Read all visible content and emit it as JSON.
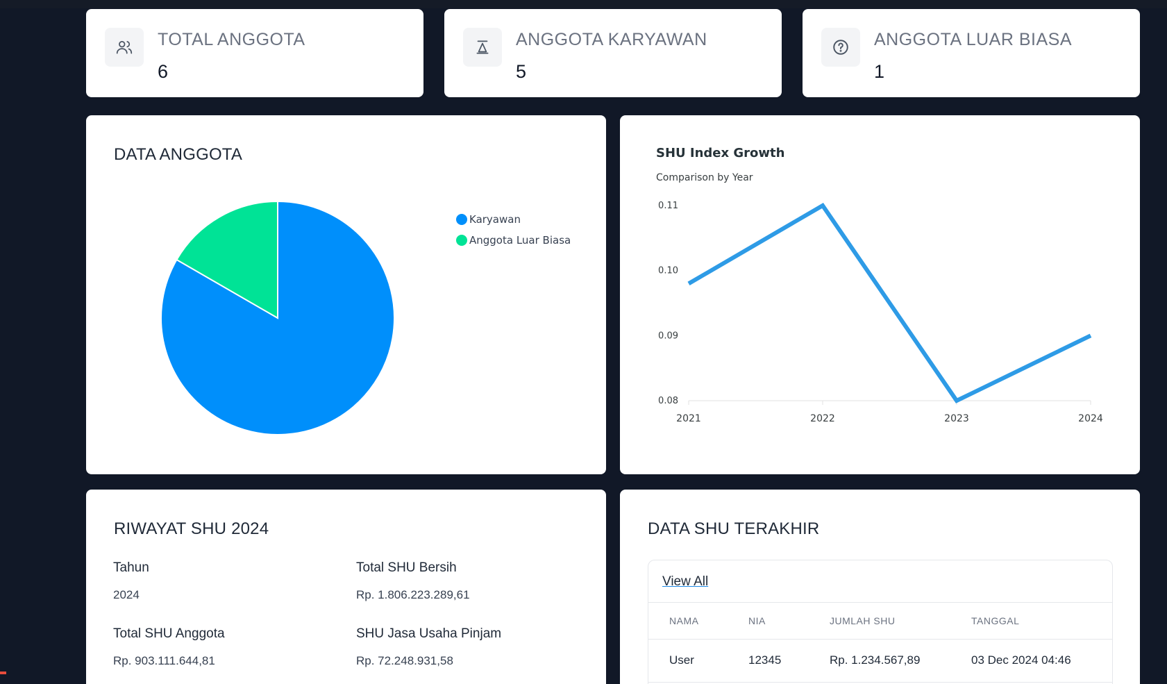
{
  "stats": [
    {
      "label": "TOTAL ANGGOTA",
      "value": "6",
      "icon": "users-icon"
    },
    {
      "label": "ANGGOTA KARYAWAN",
      "value": "5",
      "icon": "scale-icon"
    },
    {
      "label": "ANGGOTA LUAR BIASA",
      "value": "1",
      "icon": "help-circle-icon"
    }
  ],
  "data_anggota": {
    "title": "DATA ANGGOTA"
  },
  "shu_growth": {
    "title": "SHU Index Growth",
    "subtitle": "Comparison by Year"
  },
  "riwayat": {
    "title": "RIWAYAT SHU 2024",
    "tahun_label": "Tahun",
    "tahun_value": "2024",
    "total_bersih_label": "Total SHU Bersih",
    "total_bersih_value": "Rp. 1.806.223.289,61",
    "total_anggota_label": "Total SHU Anggota",
    "total_anggota_value": "Rp. 903.111.644,81",
    "jasa_label": "SHU Jasa Usaha Pinjam",
    "jasa_value": "Rp. 72.248.931,58"
  },
  "terakhir": {
    "title": "DATA SHU TERAKHIR",
    "view_all": "View All",
    "columns": [
      "NAMA",
      "NIA",
      "JUMLAH SHU",
      "TANGGAL"
    ],
    "rows": [
      [
        "User",
        "12345",
        "Rp. 1.234.567,89",
        "03 Dec 2024 04:46"
      ]
    ]
  },
  "colors": {
    "background": "#111827",
    "karyawan": "#008ffb",
    "luar_biasa": "#00e396",
    "line": "#2e9be6"
  },
  "chart_data": [
    {
      "type": "pie",
      "labels": [
        "Karyawan",
        "Anggota Luar Biasa"
      ],
      "values": [
        5,
        1
      ],
      "colors": [
        "#008ffb",
        "#00e396"
      ],
      "legend": "top-right"
    },
    {
      "type": "line",
      "title": "SHU Index Growth",
      "subtitle": "Comparison by Year",
      "x": [
        "2021",
        "2022",
        "2023",
        "2024"
      ],
      "series": [
        {
          "values": [
            0.098,
            0.11,
            0.08,
            0.09
          ]
        }
      ],
      "ylim": [
        0.08,
        0.11
      ],
      "yticks": [
        "0.08",
        "0.09",
        "0.10",
        "0.11"
      ],
      "grid": false
    }
  ]
}
